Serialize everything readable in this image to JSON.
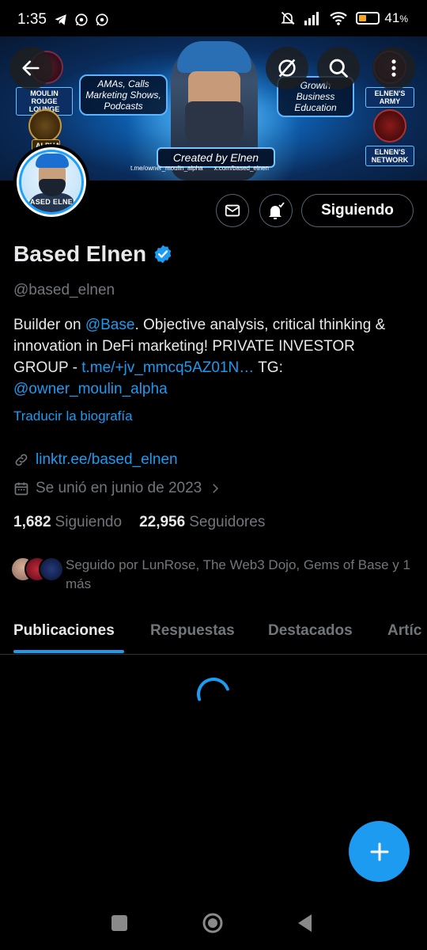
{
  "status_bar": {
    "time": "1:35",
    "battery": "41",
    "battery_unit": "%",
    "battery_level": 0.41
  },
  "banner": {
    "left_box": "AMAs, Calls Marketing Shows, Podcasts",
    "right_box": "Growth Business Education",
    "created_by": "Created by Elnen",
    "link_tg": "t.me/owner_moulin_alpha",
    "link_x": "x.com/based_elnen",
    "tag_left": "MOULIN ROUGE LOUNGE",
    "tag_alpha": "ALPHA",
    "tag_army": "ELNEN'S ARMY",
    "tag_network": "ELNEN'S NETWORK"
  },
  "avatar": {
    "label": "BASED ELNEN"
  },
  "actions": {
    "follow_label": "Siguiendo"
  },
  "profile": {
    "name": "Based Elnen",
    "handle": "@based_elnen",
    "bio": {
      "p1": "Builder on ",
      "mention_base": "@Base",
      "p2": ". Objective analysis, critical thinking & innovation in DeFi marketing! PRIVATE INVESTOR GROUP - ",
      "link": "t.me/+jv_mmcq5AZ01N…",
      "p3": " TG: ",
      "mention_tg": "@owner_moulin_alpha"
    },
    "translate": "Traducir la biografía",
    "website": "linktr.ee/based_elnen",
    "joined": "Se unió en junio de 2023",
    "following_count": "1,682",
    "following_label": "Siguiendo",
    "followers_count": "22,956",
    "followers_label": "Seguidores",
    "followed_by": "Seguido por LunRose, The Web3 Dojo, Gems of Base y 1 más"
  },
  "tabs": [
    "Publicaciones",
    "Respuestas",
    "Destacados",
    "Artíc"
  ],
  "colors": {
    "accent": "#1d9bf0",
    "background": "#000000",
    "muted": "#71767b"
  }
}
